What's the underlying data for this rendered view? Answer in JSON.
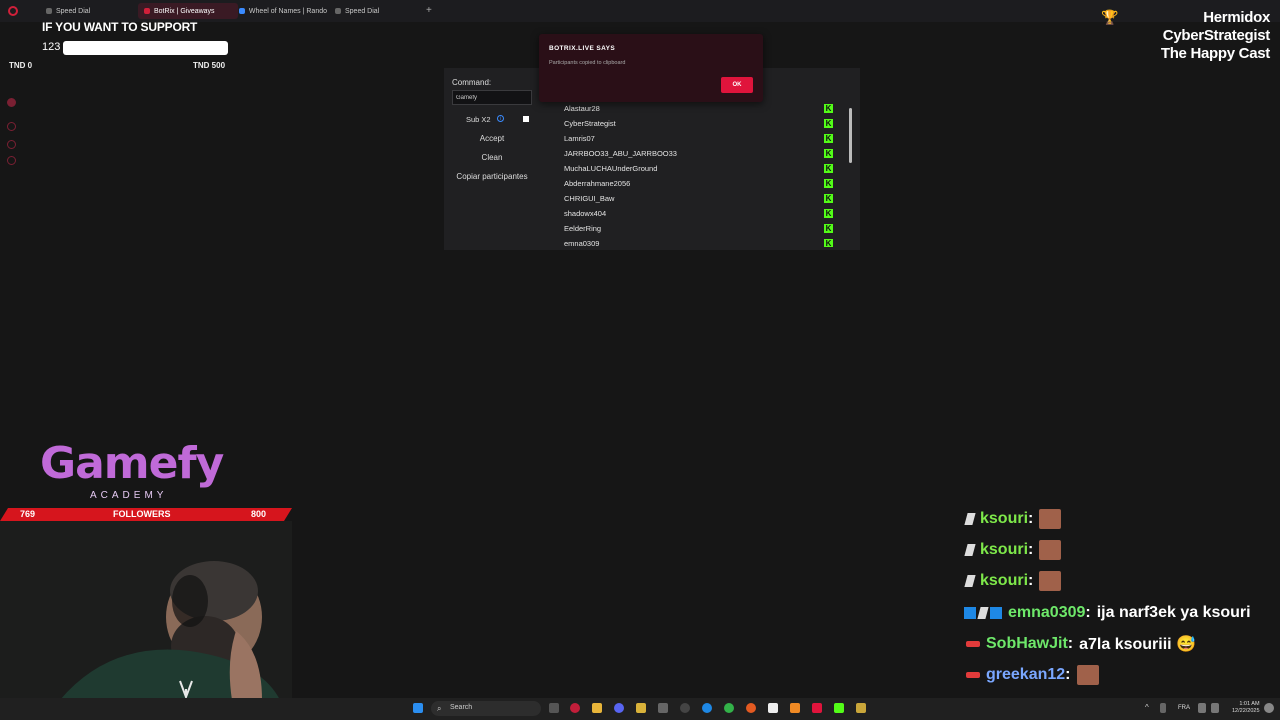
{
  "browser": {
    "tabs": [
      {
        "label": "Speed Dial",
        "active": false
      },
      {
        "label": "BotRix | Giveaways",
        "active": true
      },
      {
        "label": "Wheel of Names | Rando",
        "active": false
      },
      {
        "label": "Speed Dial",
        "active": false
      }
    ],
    "new_tab_icon": "plus-icon"
  },
  "support_overlay": {
    "title": "IF YOU WANT TO SUPPORT",
    "amount": "123",
    "min_label": "TND 0",
    "max_label": "TND 500"
  },
  "top_right": {
    "trophy_icon": "trophy-icon",
    "names": [
      "Hermidox",
      "CyberStrategist",
      "The Happy Cast"
    ]
  },
  "botrix_panel": {
    "command_label": "Command:",
    "command_value": "Gamefy",
    "sub_x2_label": "Sub X2",
    "accept_label": "Accept",
    "clean_label": "Clean",
    "copy_label": "Copiar participantes",
    "participants": [
      "Alastaur28",
      "CyberStrategist",
      "Lamris07",
      "JARRBOO33_ABU_JARRBOO33",
      "MuchaLUCHAUnderGround",
      "Abderrahmane2056",
      "CHRIGUI_Baw",
      "shadowx404",
      "EelderRing",
      "emna0309"
    ],
    "platform_icon": "kick-icon",
    "platform_letter": "K"
  },
  "dialog": {
    "title": "BOTRIX.LIVE SAYS",
    "message": "Participants copied to clipboard",
    "ok_label": "OK"
  },
  "logo": {
    "word": "Gamefy",
    "sub": "ACADEMY"
  },
  "followers": {
    "current": "769",
    "label": "FOLLOWERS",
    "goal": "800",
    "progress": 0.961
  },
  "chat": [
    {
      "user": "ksouri",
      "sep": " :",
      "message": "",
      "color": "#7ee84a",
      "emote": true
    },
    {
      "user": "ksouri",
      "sep": " :",
      "message": "",
      "color": "#7ee84a",
      "emote": true
    },
    {
      "user": "ksouri",
      "sep": " :",
      "message": "",
      "color": "#7ee84a",
      "emote": true
    },
    {
      "user": "emna0309",
      "sep": " :",
      "message": "ija narf3ek ya ksouri",
      "color": "#6ee86a",
      "emote": false
    },
    {
      "user": "SobHawJit",
      "sep": " :",
      "message": "a7la ksouriii 😅",
      "color": "#6ee86a",
      "emote": false
    },
    {
      "user": "greekan12",
      "sep": " :",
      "message": "",
      "color": "#7aa7ff",
      "emote": true
    }
  ],
  "taskbar": {
    "search_label": "Search",
    "language": "FRA",
    "time": "1:01 AM",
    "date": "12/22/2025"
  }
}
